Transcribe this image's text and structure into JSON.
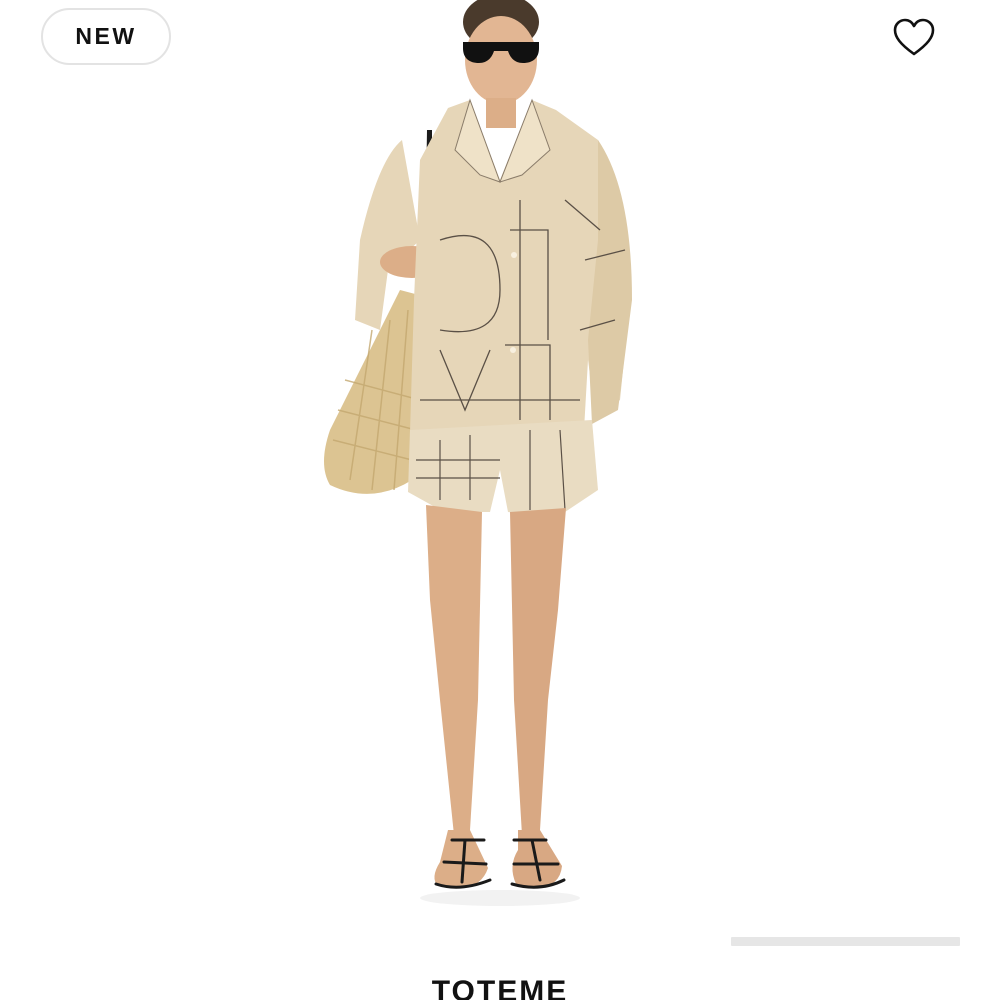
{
  "badge": {
    "label": "NEW"
  },
  "wishlist": {
    "icon": "heart-outline-icon"
  },
  "product": {
    "brand": "TOTEME",
    "image_description_icon": "model-wearing-outfit-image",
    "colors": {
      "outfit": "#e6d6b8",
      "outfit_shadow": "#cdb994",
      "monogram_lines": "#5a5046",
      "skin": "#dcae88",
      "bag": "#dcc492"
    }
  },
  "carousel": {
    "active_index": 1,
    "total": 4
  }
}
